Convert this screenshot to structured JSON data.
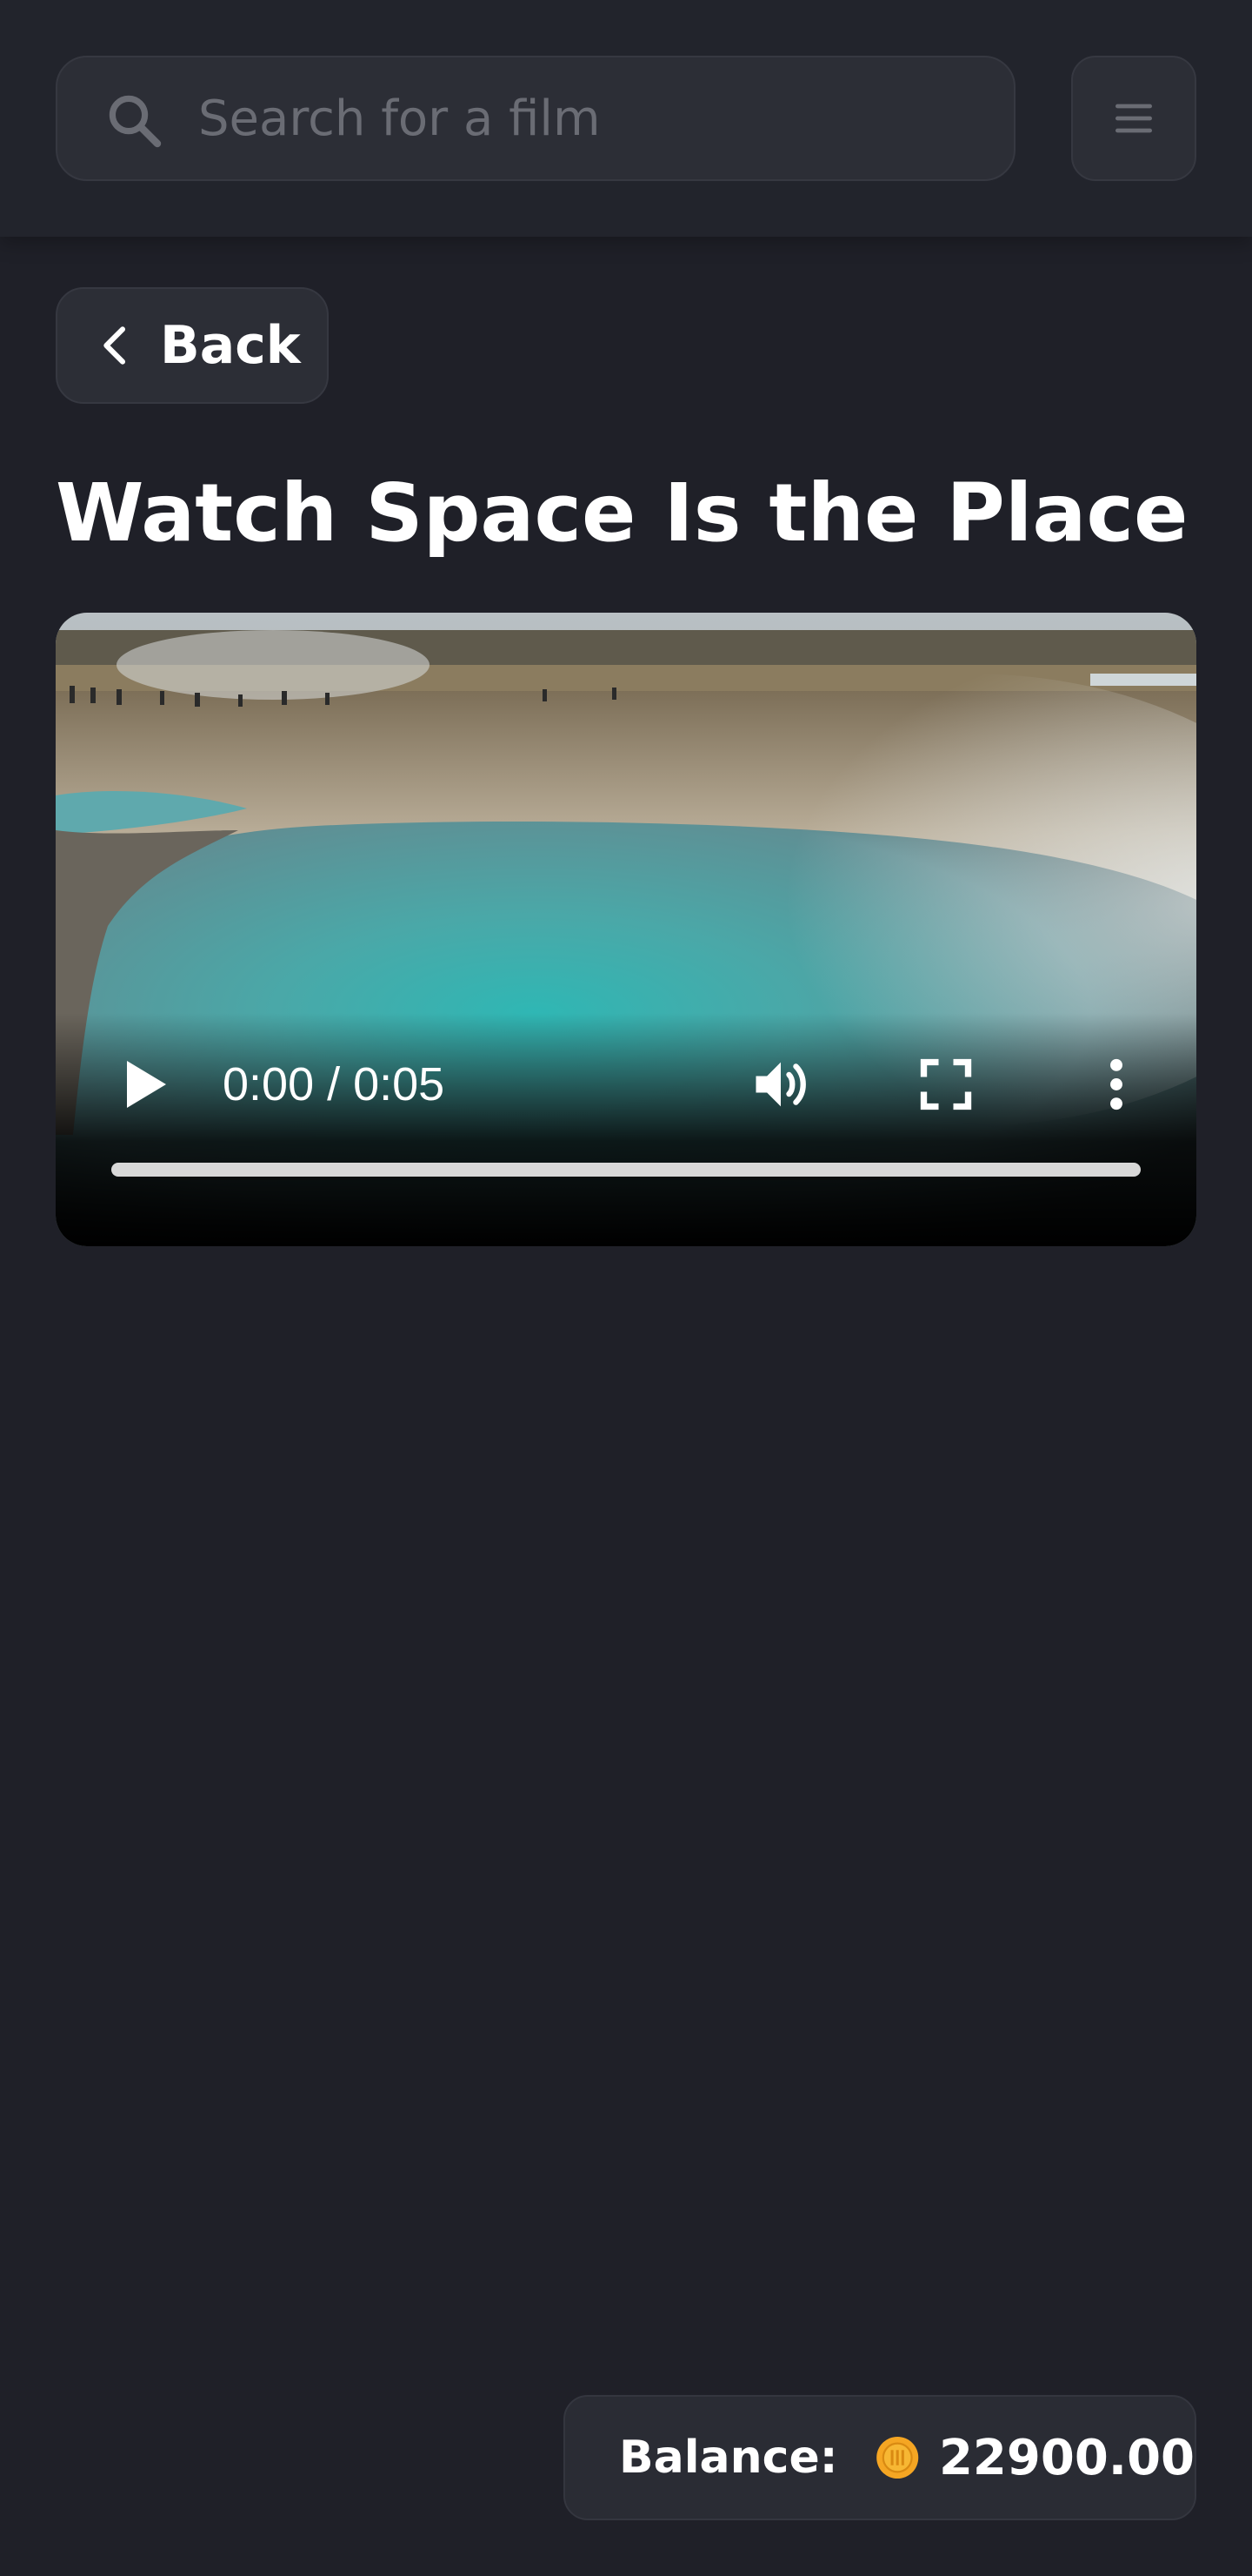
{
  "search": {
    "placeholder": "Search for a film",
    "value": ""
  },
  "icons": {
    "search": "search-icon",
    "menu": "hamburger-menu-icon",
    "back": "chevron-left-icon",
    "play": "play-icon",
    "volume": "volume-icon",
    "fullscreen": "fullscreen-icon",
    "more": "more-vertical-icon",
    "coin": "coin-icon"
  },
  "back_button": {
    "label": "Back"
  },
  "page": {
    "title": "Watch Space Is the Place"
  },
  "video": {
    "current_time": "0:00",
    "duration": "0:05",
    "time_display": "0:00 / 0:05",
    "progress": 0
  },
  "balance": {
    "label": "Balance:",
    "amount": "22900.00"
  },
  "colors": {
    "background": "#1f2028",
    "surface": "#2c2e36",
    "text": "#ffffff",
    "muted": "#6a6c74",
    "coin": "#f5a623"
  }
}
